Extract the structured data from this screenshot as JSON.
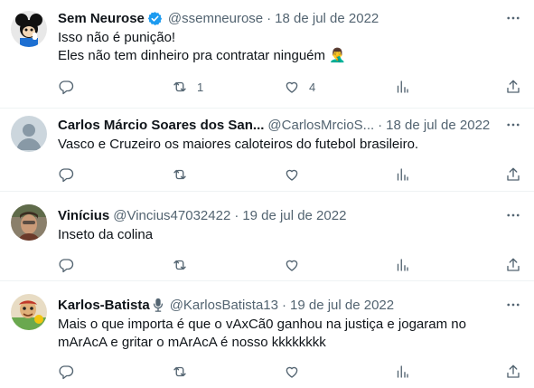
{
  "tweets": [
    {
      "name": "Sem Neurose",
      "handle": "@ssemneurose",
      "separator": "·",
      "date": "18 de jul de 2022",
      "verified": true,
      "text": "Isso não é punição!\nEles não tem dinheiro pra contratar ninguém 🤦‍♂️",
      "reply_count": "",
      "retweet_count": "1",
      "like_count": "4"
    },
    {
      "name": "Carlos Márcio Soares dos San...",
      "handle": "@CarlosMrcioS...",
      "separator": "·",
      "date": "18 de jul de 2022",
      "text": "Vasco e Cruzeiro os maiores caloteiros do futebol brasileiro.",
      "reply_count": "",
      "retweet_count": "",
      "like_count": ""
    },
    {
      "name": "Vinícius",
      "handle": "@Vincius47032422",
      "separator": "·",
      "date": "19 de jul de 2022",
      "text": "Inseto da colina",
      "reply_count": "",
      "retweet_count": "",
      "like_count": ""
    },
    {
      "name": "Karlos-Batista",
      "name_suffix_icon": "microphone-icon",
      "handle": "@KarlosBatista13",
      "separator": "·",
      "date": "19 de jul de 2022",
      "text": "Mais o que importa é que o vAxCã0 ganhou na justiça e jogaram no\nmArAcA e gritar o mArAcA é nosso kkkkkkkk",
      "reply_count": "",
      "retweet_count": "",
      "like_count": ""
    }
  ],
  "colors": {
    "text_primary": "#0f1419",
    "text_secondary": "#536471",
    "verified_blue": "#1d9bf0",
    "divider": "#eff3f4"
  }
}
